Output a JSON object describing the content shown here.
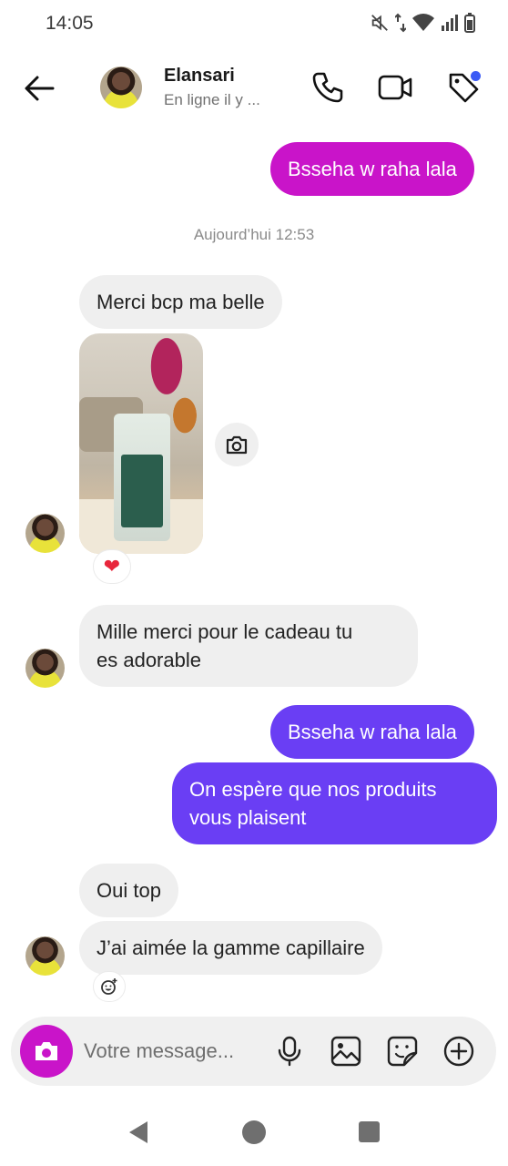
{
  "status_bar": {
    "time": "14:05"
  },
  "header": {
    "name": "Elansari",
    "status": "En ligne il y ...",
    "icons": [
      "back-arrow-icon",
      "phone-icon",
      "video-camera-icon",
      "tag-icon"
    ],
    "notification_dot_color": "#3b5bf5"
  },
  "messages": {
    "m1": "Bsseha w raha lala",
    "date": "Aujourd’hui 12:53",
    "m2": "Merci bcp ma belle",
    "photo_reaction": "❤",
    "m3_line1": "Mille merci pour le cadeau tu",
    "m3_line2": "es adorable",
    "m4": "Bsseha w raha lala",
    "m5_line1": "On espère que nos produits",
    "m5_line2": "vous plaisent",
    "m6": "Oui top",
    "m7": "J’ai aimée la gamme capillaire"
  },
  "composer": {
    "placeholder": "Votre message...",
    "icons": [
      "camera-icon",
      "microphone-icon",
      "gallery-icon",
      "sticker-icon",
      "plus-icon"
    ]
  },
  "colors": {
    "accent_pink": "#c914c9",
    "accent_purple": "#6a3ef4",
    "incoming_bubble": "#efefef"
  }
}
